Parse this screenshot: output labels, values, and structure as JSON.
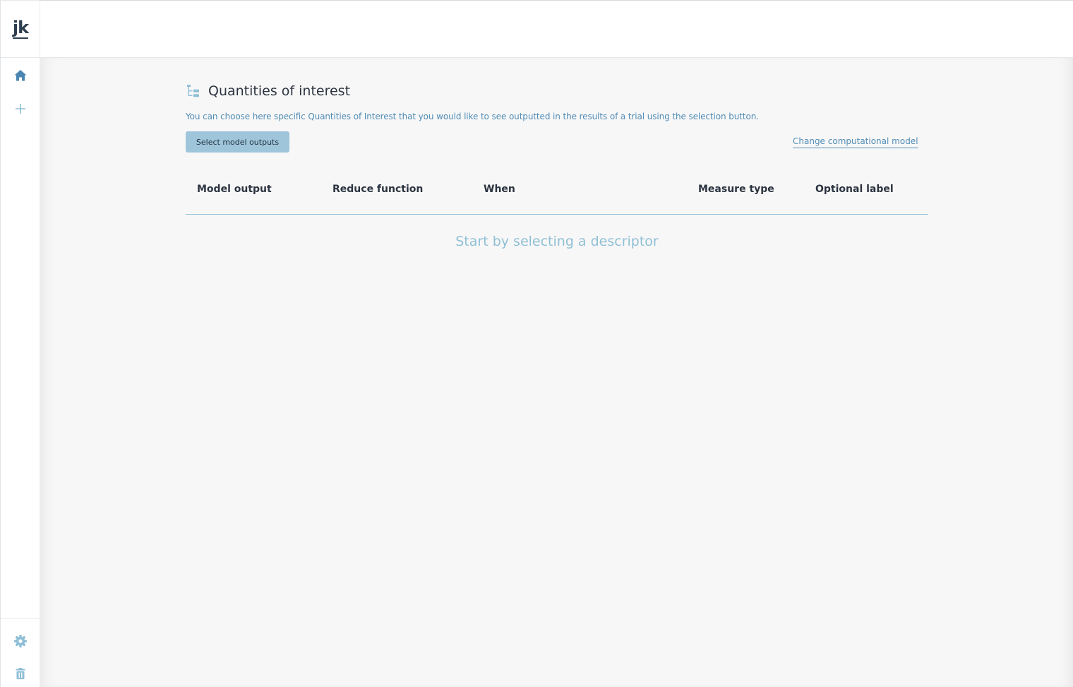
{
  "sidebar": {
    "logo_text": "jk",
    "items": [
      {
        "icon": "home-icon",
        "color": "#4b86b2"
      },
      {
        "icon": "plus-icon",
        "color": "#8fbfd6"
      }
    ],
    "bottom_items": [
      {
        "icon": "gear-icon",
        "color": "#8fbfd6"
      },
      {
        "icon": "trash-icon",
        "color": "#8fbfd6"
      }
    ]
  },
  "page": {
    "title": "Quantities of interest",
    "subtitle": "You can choose here specific Quantities of Interest that you would like to see outputted in the results of a trial using the selection button.",
    "select_button_label": "Select model outputs",
    "change_model_link": "Change computational model",
    "empty_state": "Start by selecting a descriptor"
  },
  "table": {
    "columns": [
      "Model output",
      "Reduce function",
      "When",
      "Measure type",
      "Optional label"
    ]
  },
  "colors": {
    "accent": "#4f8db7",
    "button_bg": "#9ec5da",
    "empty_text": "#8fc0d6",
    "divider": "#8fbfd6"
  }
}
